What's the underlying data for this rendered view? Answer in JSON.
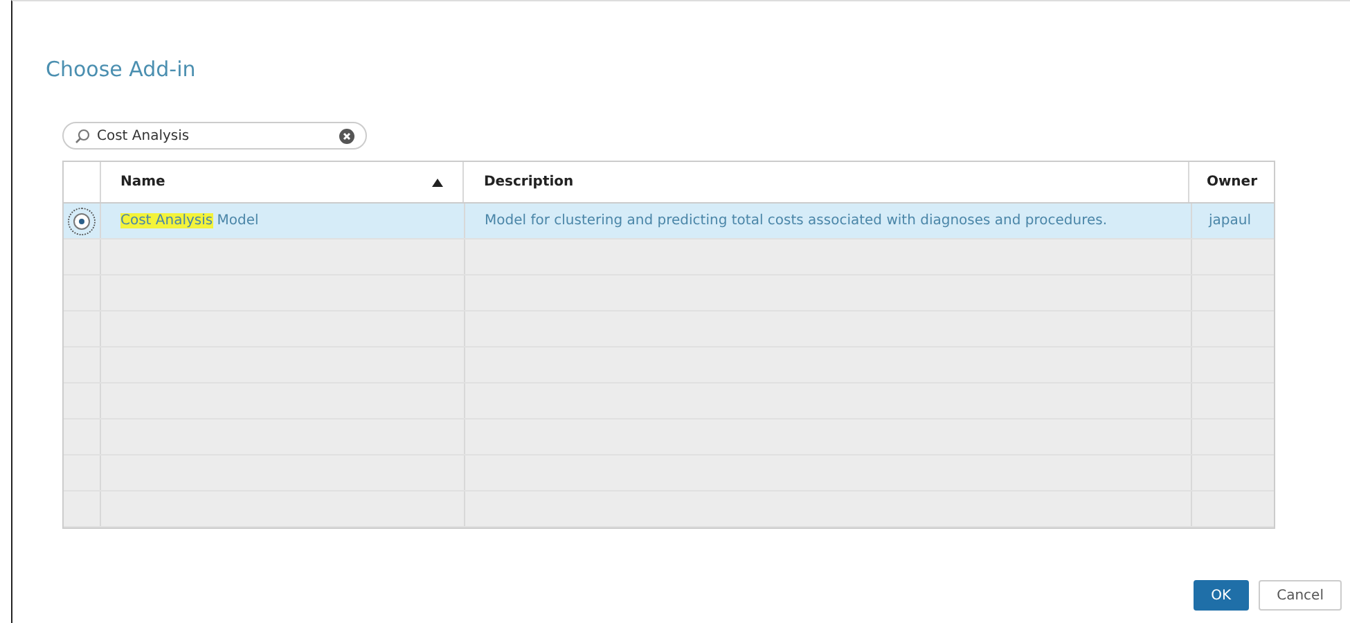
{
  "dialog": {
    "title": "Choose Add-in"
  },
  "search": {
    "value": "Cost Analysis"
  },
  "table": {
    "columns": [
      {
        "label": "Name",
        "sorted": true
      },
      {
        "label": "Description",
        "sorted": false
      },
      {
        "label": "Owner",
        "sorted": false
      }
    ],
    "rows": [
      {
        "selected": true,
        "name_match": "Cost Analysis",
        "name_rest": " Model",
        "description": "Model for clustering and predicting total costs associated with diagnoses and procedures.",
        "owner": "japaul"
      }
    ]
  },
  "buttons": [
    {
      "label": "OK",
      "kind": "primary"
    },
    {
      "label": "Cancel",
      "kind": "secondary"
    }
  ]
}
